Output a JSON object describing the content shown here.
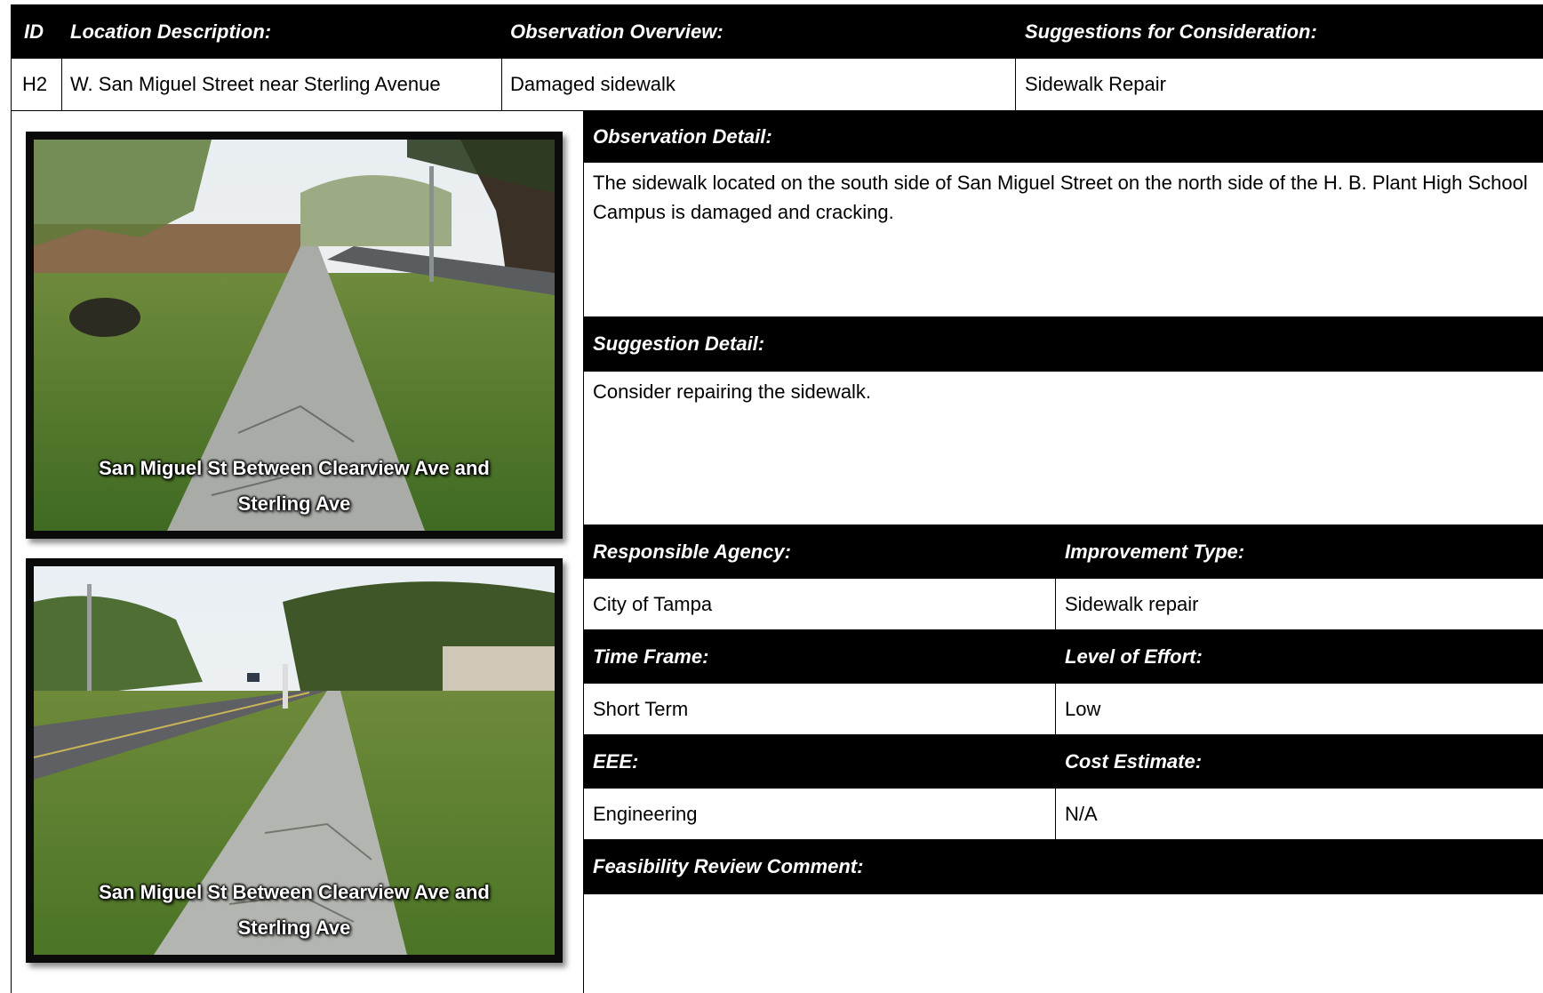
{
  "header": {
    "id_label": "ID",
    "location_label": "Location Description:",
    "observation_label": "Observation Overview:",
    "suggestions_label": "Suggestions for Consideration:"
  },
  "row": {
    "id": "H2",
    "location": "W. San Miguel Street near Sterling Avenue",
    "observation": "Damaged sidewalk",
    "suggestion": "Sidewalk Repair"
  },
  "photos": [
    {
      "caption_line1": "San Miguel St Between Clearview Ave and",
      "caption_line2": "Sterling Ave"
    },
    {
      "caption_line1": "San Miguel St Between Clearview Ave and",
      "caption_line2": "Sterling Ave"
    }
  ],
  "observation_detail": {
    "label": "Observation Detail:",
    "text": "The sidewalk located on the south side of San Miguel Street on the north side of the H. B. Plant High School Campus is damaged and cracking."
  },
  "suggestion_detail": {
    "label": "Suggestion Detail:",
    "text": "Consider repairing the sidewalk."
  },
  "fields": {
    "agency_label": "Responsible Agency:",
    "agency": "City of Tampa",
    "improvement_label": "Improvement Type:",
    "improvement": "Sidewalk repair",
    "timeframe_label": "Time Frame:",
    "timeframe": "Short Term",
    "effort_label": "Level of Effort:",
    "effort": "Low",
    "eee_label": "EEE:",
    "eee": "Engineering",
    "cost_label": "Cost Estimate:",
    "cost": "N/A"
  },
  "feasibility": {
    "label": "Feasibility Review Comment:",
    "text": ""
  }
}
